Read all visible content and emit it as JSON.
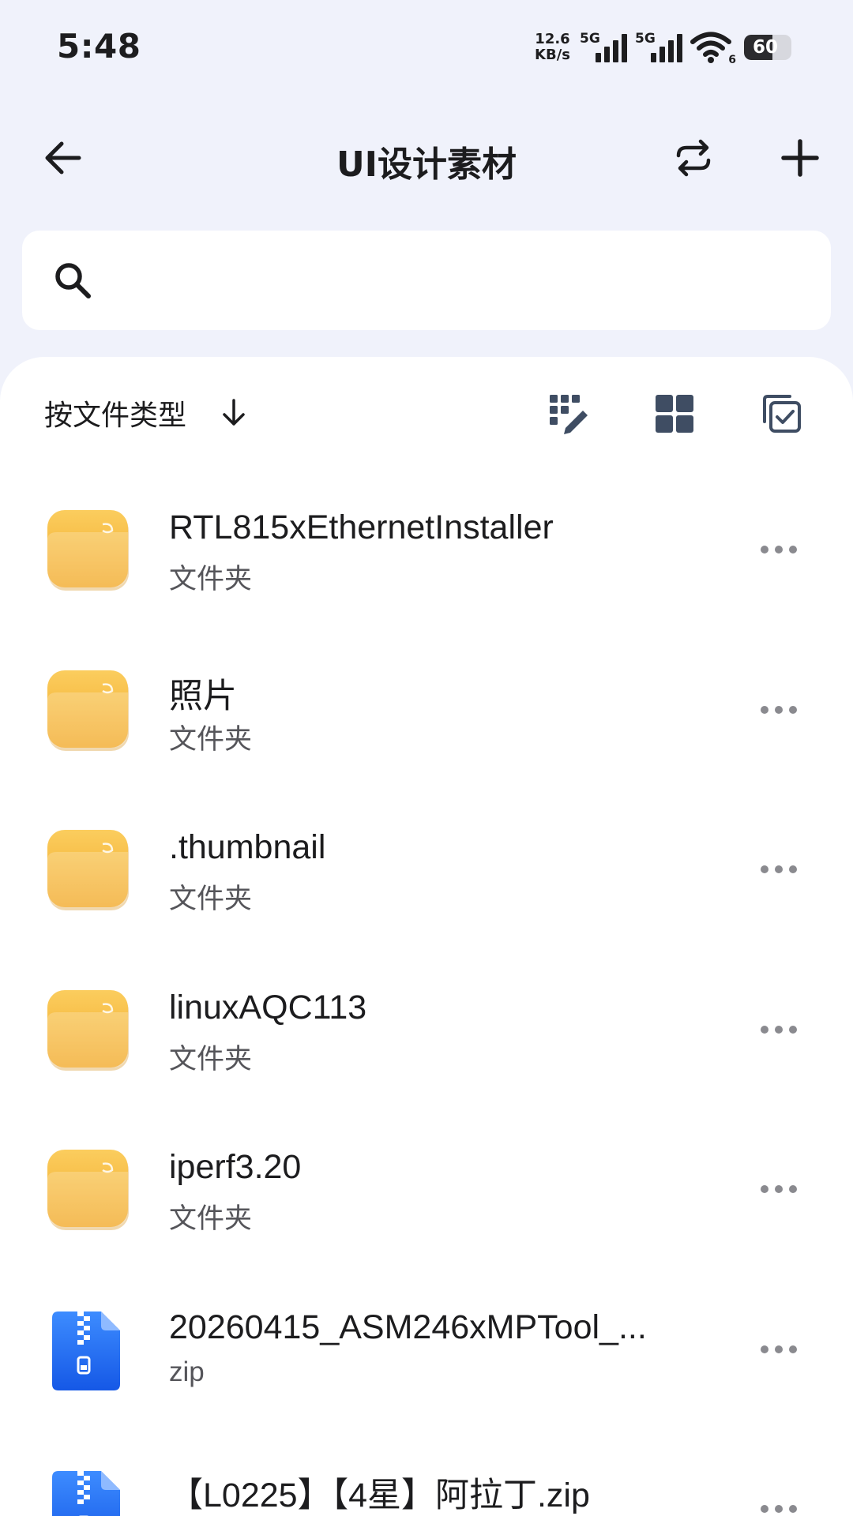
{
  "status_bar": {
    "time": "5:48",
    "net_speed_value": "12.6",
    "net_speed_unit": "KB/s",
    "sim1_label": "5G",
    "sim2_label": "5G",
    "wifi_label": "6",
    "battery_level": 60,
    "battery_text": "60"
  },
  "header": {
    "title": "UI设计素材",
    "back_icon": "arrow-left-icon",
    "sync_icon": "swap-arrows-icon",
    "add_icon": "plus-icon"
  },
  "search": {
    "icon": "search-icon",
    "placeholder": "",
    "value": ""
  },
  "toolbar": {
    "sort_label": "按文件类型",
    "sort_icon": "arrow-down-icon",
    "edit_icon": "grid-edit-icon",
    "view_icon": "grid-view-icon",
    "select_icon": "multi-select-icon"
  },
  "files": [
    {
      "name": "RTL815xEthernetInstaller",
      "type": "文件夹",
      "icon": "folder-icon"
    },
    {
      "name": "照片",
      "type": "文件夹",
      "icon": "folder-icon"
    },
    {
      "name": ".thumbnail",
      "type": "文件夹",
      "icon": "folder-icon"
    },
    {
      "name": "linuxAQC113",
      "type": "文件夹",
      "icon": "folder-icon"
    },
    {
      "name": "iperf3.20",
      "type": "文件夹",
      "icon": "folder-icon"
    },
    {
      "name": "20260415_ASM246xMPTool_...",
      "type": "zip",
      "icon": "zip-icon"
    },
    {
      "name": "【L0225】【4星】阿拉丁.zip",
      "type": "",
      "icon": "zip-icon"
    }
  ],
  "colors": {
    "background": "#f0f2fb",
    "surface": "#ffffff",
    "text_primary": "#1c1c1e",
    "text_secondary": "#55555a",
    "icon_dark": "#3f4d63",
    "folder_yellow": "#f7b733",
    "zip_blue": "#1f6ff5"
  }
}
